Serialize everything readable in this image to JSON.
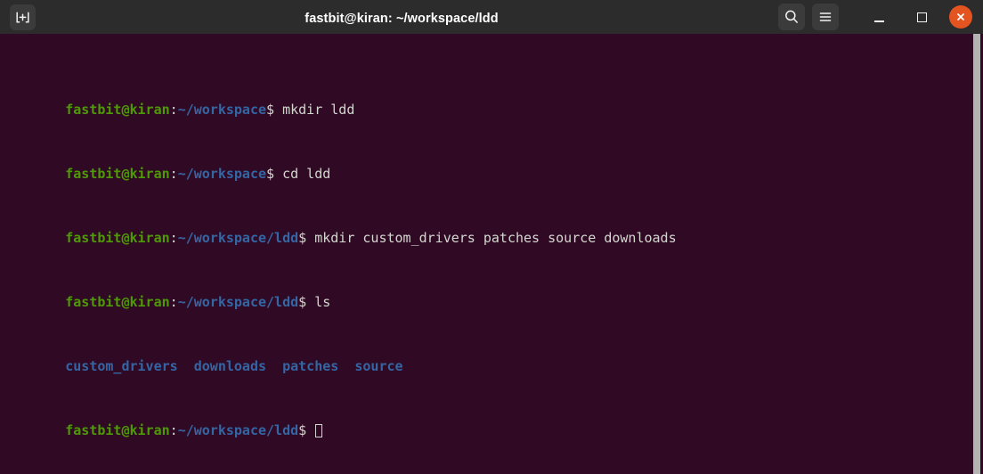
{
  "window": {
    "title": "fastbit@kiran: ~/workspace/ldd",
    "titlebar_bg": "#2c2c2c",
    "close_color": "#e35420",
    "new_tab_icon": "new-tab-icon",
    "search_icon": "search-icon",
    "menu_icon": "hamburger-menu-icon",
    "minimize_icon": "minimize-icon",
    "maximize_icon": "maximize-icon",
    "close_icon": "close-icon"
  },
  "terminal": {
    "bg": "#300a24",
    "fg": "#d3d7cf",
    "user_color": "#4e9a06",
    "path_color": "#3465a4",
    "prompt_user": "fastbit@kiran",
    "colon": ":",
    "dollar": "$",
    "lines": [
      {
        "type": "prompt",
        "user": "fastbit@kiran",
        "colon": ":",
        "path": "~/workspace",
        "dollar": "$",
        "command": " mkdir ldd"
      },
      {
        "type": "prompt",
        "user": "fastbit@kiran",
        "colon": ":",
        "path": "~/workspace",
        "dollar": "$",
        "command": " cd ldd"
      },
      {
        "type": "prompt",
        "user": "fastbit@kiran",
        "colon": ":",
        "path": "~/workspace/ldd",
        "dollar": "$",
        "command": " mkdir custom_drivers patches source downloads"
      },
      {
        "type": "prompt",
        "user": "fastbit@kiran",
        "colon": ":",
        "path": "~/workspace/ldd",
        "dollar": "$",
        "command": " ls"
      },
      {
        "type": "output",
        "entries": [
          "custom_drivers",
          "downloads",
          "patches",
          "source"
        ],
        "text": "custom_drivers  downloads  patches  source"
      },
      {
        "type": "prompt",
        "user": "fastbit@kiran",
        "colon": ":",
        "path": "~/workspace/ldd",
        "dollar": "$",
        "command": " ",
        "cursor": true
      }
    ]
  },
  "scrollbar": {
    "thumb_color": "#b5b2b2"
  }
}
